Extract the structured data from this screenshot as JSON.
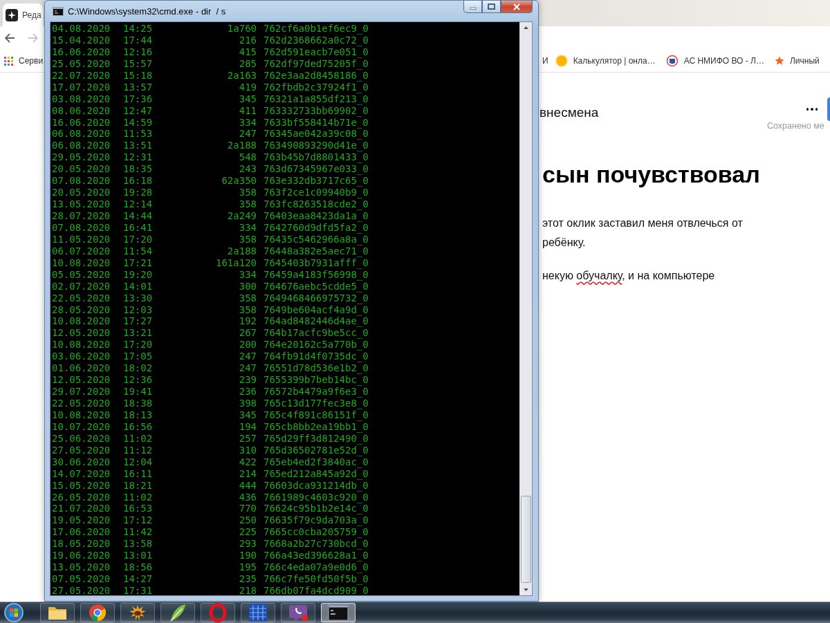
{
  "browser": {
    "tab": {
      "title": "Реда"
    },
    "navigation": {
      "forward_disabled": true
    },
    "bookmarks": [
      {
        "label": "Серви",
        "kind": "apps"
      },
      {
        "label": "И",
        "kind": "none"
      },
      {
        "label": "Калькулятор | онла…",
        "kind": "circle"
      },
      {
        "label": "АС НМИФО ВО - Л…",
        "kind": "shield"
      },
      {
        "label": "Личный",
        "kind": "star"
      }
    ],
    "article": {
      "title": "внесмена",
      "saved_status": "Сохранено ме",
      "heading": "сын почувствовал",
      "paragraphs": [
        {
          "lines": [
            {
              "parts": [
                {
                  "text": "этот оклик заставил меня отвлечься от",
                  "misspelled": false
                }
              ]
            },
            {
              "parts": [
                {
                  "text": "ребёнку.",
                  "misspelled": false
                }
              ]
            }
          ]
        },
        {
          "lines": [
            {
              "parts": [
                {
                  "text": "некую ",
                  "misspelled": false
                },
                {
                  "text": "обучалку",
                  "misspelled": true
                },
                {
                  "text": ", и на компьютере",
                  "misspelled": false
                }
              ]
            }
          ]
        }
      ]
    }
  },
  "console": {
    "title": "C:\\Windows\\system32\\cmd.exe - dir  / s",
    "lines": [
      {
        "date": "04.08.2020",
        "time": "14:25",
        "size": "1a760",
        "name": "762cf6a0b1ef6ec9_0"
      },
      {
        "date": "15.04.2020",
        "time": "17:44",
        "size": "216",
        "name": "762d2368662a0c72_0"
      },
      {
        "date": "16.06.2020",
        "time": "12:16",
        "size": "415",
        "name": "762d591eacb7e051_0"
      },
      {
        "date": "25.05.2020",
        "time": "15:57",
        "size": "285",
        "name": "762df97ded75205f_0"
      },
      {
        "date": "22.07.2020",
        "time": "15:18",
        "size": "2a163",
        "name": "762e3aa2d8458186_0"
      },
      {
        "date": "17.07.2020",
        "time": "13:57",
        "size": "419",
        "name": "762fbdb2c37924f1_0"
      },
      {
        "date": "03.08.2020",
        "time": "17:36",
        "size": "345",
        "name": "76321a1a855df213_0"
      },
      {
        "date": "08.06.2020",
        "time": "12:47",
        "size": "411",
        "name": "763332733bb69902_0"
      },
      {
        "date": "16.06.2020",
        "time": "14:59",
        "size": "334",
        "name": "7633bf558414b71e_0"
      },
      {
        "date": "06.08.2020",
        "time": "11:53",
        "size": "247",
        "name": "76345ae042a39c08_0"
      },
      {
        "date": "06.08.2020",
        "time": "13:51",
        "size": "2a188",
        "name": "763490893290d41e_0"
      },
      {
        "date": "29.05.2020",
        "time": "12:31",
        "size": "548",
        "name": "763b45b7d8801433_0"
      },
      {
        "date": "20.05.2020",
        "time": "18:35",
        "size": "243",
        "name": "763d67345967e033_0"
      },
      {
        "date": "07.08.2020",
        "time": "16:18",
        "size": "62a350",
        "name": "763e332db3717c65_0"
      },
      {
        "date": "20.05.2020",
        "time": "19:28",
        "size": "358",
        "name": "763f2ce1c09940b9_0"
      },
      {
        "date": "13.05.2020",
        "time": "12:14",
        "size": "358",
        "name": "763fc8263518cde2_0"
      },
      {
        "date": "28.07.2020",
        "time": "14:44",
        "size": "2a249",
        "name": "76403eaa8423da1a_0"
      },
      {
        "date": "07.08.2020",
        "time": "16:41",
        "size": "334",
        "name": "7642760d9dfd5fa2_0"
      },
      {
        "date": "11.05.2020",
        "time": "17:20",
        "size": "358",
        "name": "76435c5462966a8a_0"
      },
      {
        "date": "06.07.2020",
        "time": "11:54",
        "size": "2a188",
        "name": "76448a382e5aec71_0"
      },
      {
        "date": "10.08.2020",
        "time": "17:21",
        "size": "161a120",
        "name": "7645403b7931afff_0"
      },
      {
        "date": "05.05.2020",
        "time": "19:20",
        "size": "334",
        "name": "76459a4183f56998_0"
      },
      {
        "date": "02.07.2020",
        "time": "14:01",
        "size": "300",
        "name": "764676aebc5cdde5_0"
      },
      {
        "date": "22.05.2020",
        "time": "13:30",
        "size": "358",
        "name": "7649468466975732_0"
      },
      {
        "date": "28.05.2020",
        "time": "12:03",
        "size": "358",
        "name": "7649be604acf4a9d_0"
      },
      {
        "date": "10.08.2020",
        "time": "17:27",
        "size": "192",
        "name": "764ad8482446d4ae_0"
      },
      {
        "date": "12.05.2020",
        "time": "13:21",
        "size": "267",
        "name": "764b17acfc9be5cc_0"
      },
      {
        "date": "10.08.2020",
        "time": "17:20",
        "size": "200",
        "name": "764e20162c5a770b_0"
      },
      {
        "date": "03.06.2020",
        "time": "17:05",
        "size": "247",
        "name": "764fb91d4f0735dc_0"
      },
      {
        "date": "01.06.2020",
        "time": "18:02",
        "size": "247",
        "name": "76551d78d536e1b2_0"
      },
      {
        "date": "12.05.2020",
        "time": "12:36",
        "size": "239",
        "name": "7655399b7beb14bc_0"
      },
      {
        "date": "29.07.2020",
        "time": "19:41",
        "size": "236",
        "name": "76572b4479a9f6e3_0"
      },
      {
        "date": "22.05.2020",
        "time": "18:38",
        "size": "398",
        "name": "765c13d177fec3e8_0"
      },
      {
        "date": "10.08.2020",
        "time": "18:13",
        "size": "345",
        "name": "765c4f891c86151f_0"
      },
      {
        "date": "10.07.2020",
        "time": "16:56",
        "size": "194",
        "name": "765cb8bb2ea19bb1_0"
      },
      {
        "date": "25.06.2020",
        "time": "11:02",
        "size": "257",
        "name": "765d29ff3d812490_0"
      },
      {
        "date": "27.05.2020",
        "time": "11:12",
        "size": "310",
        "name": "765d36502781e52d_0"
      },
      {
        "date": "30.06.2020",
        "time": "12:04",
        "size": "422",
        "name": "765eb4ed2f3840ac_0"
      },
      {
        "date": "14.07.2020",
        "time": "16:11",
        "size": "214",
        "name": "765ed212a845a92d_0"
      },
      {
        "date": "15.05.2020",
        "time": "18:21",
        "size": "444",
        "name": "76603dca931214db_0"
      },
      {
        "date": "26.05.2020",
        "time": "11:02",
        "size": "436",
        "name": "7661989c4603c920_0"
      },
      {
        "date": "21.07.2020",
        "time": "16:53",
        "size": "770",
        "name": "76624c95b1b2e14c_0"
      },
      {
        "date": "19.05.2020",
        "time": "17:12",
        "size": "250",
        "name": "76635f79c9da703a_0"
      },
      {
        "date": "17.06.2020",
        "time": "11:42",
        "size": "225",
        "name": "7665cc0cba205759_0"
      },
      {
        "date": "18.05.2020",
        "time": "13:58",
        "size": "293",
        "name": "7668a2b27c730bcd_0"
      },
      {
        "date": "19.06.2020",
        "time": "13:01",
        "size": "190",
        "name": "766a43ed396628a1_0"
      },
      {
        "date": "13.05.2020",
        "time": "18:56",
        "size": "195",
        "name": "766c4eda07a9e0d6_0"
      },
      {
        "date": "07.05.2020",
        "time": "14:27",
        "size": "235",
        "name": "766c7fe50fd50f5b_0"
      },
      {
        "date": "27.05.2020",
        "time": "17:31",
        "size": "218",
        "name": "766db07fa4dcd909_0"
      }
    ]
  },
  "taskbar": {
    "items": [
      {
        "kind": "folder",
        "selected": false,
        "notification": false
      },
      {
        "kind": "chrome",
        "selected": false,
        "notification": false
      },
      {
        "kind": "sun",
        "selected": false,
        "notification": false
      },
      {
        "kind": "feather",
        "selected": false,
        "notification": false
      },
      {
        "kind": "ring",
        "selected": false,
        "notification": false
      },
      {
        "kind": "grid",
        "selected": false,
        "notification": false
      },
      {
        "kind": "phone",
        "selected": false,
        "notification": true
      },
      {
        "kind": "terminal",
        "selected": true,
        "notification": false
      }
    ]
  }
}
